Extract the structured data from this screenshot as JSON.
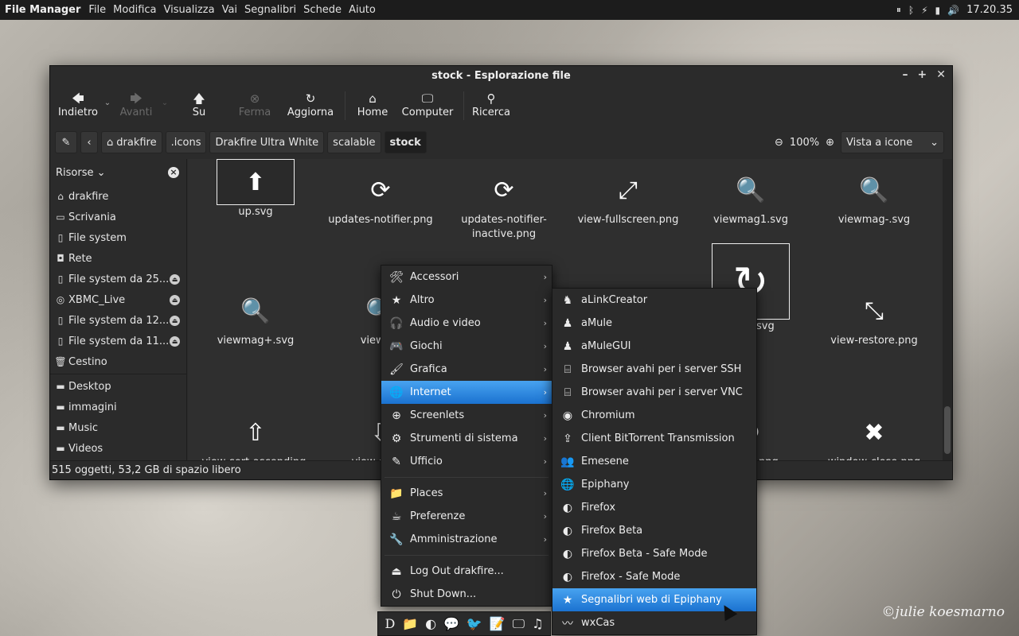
{
  "top_panel": {
    "app_name": "File Manager",
    "menus": [
      "File",
      "Modifica",
      "Visualizza",
      "Vai",
      "Segnalibri",
      "Schede",
      "Aiuto"
    ],
    "clock": "17.20.35"
  },
  "window": {
    "title": "stock - Esplorazione file",
    "toolbar": {
      "back": "Indietro",
      "forward": "Avanti",
      "up": "Su",
      "stop": "Ferma",
      "reload": "Aggiorna",
      "home": "Home",
      "computer": "Computer",
      "search": "Ricerca"
    },
    "breadcrumbs": [
      "drakfire",
      ".icons",
      "Drakfire Ultra White",
      "scalable",
      "stock"
    ],
    "zoom": "100%",
    "view_mode": "Vista a icone",
    "sidebar": {
      "header": "Risorse",
      "places": [
        {
          "label": "drakfire",
          "icon": "home-icon",
          "eject": false
        },
        {
          "label": "Scrivania",
          "icon": "desktop-icon",
          "eject": false
        },
        {
          "label": "File system",
          "icon": "drive-icon",
          "eject": false
        },
        {
          "label": "Rete",
          "icon": "network-icon",
          "eject": false
        },
        {
          "label": "File system da 25...",
          "icon": "drive-icon",
          "eject": true
        },
        {
          "label": "XBMC_Live",
          "icon": "disc-icon",
          "eject": true
        },
        {
          "label": "File system da 12...",
          "icon": "drive-icon",
          "eject": true
        },
        {
          "label": "File system da 11...",
          "icon": "drive-icon",
          "eject": true
        },
        {
          "label": "Cestino",
          "icon": "trash-icon",
          "eject": false
        }
      ],
      "bookmarks": [
        "Desktop",
        "immagini",
        "Music",
        "Videos"
      ]
    },
    "files": [
      {
        "name": "up.svg",
        "glyph": "⬆"
      },
      {
        "name": "updates-notifier.png",
        "glyph": "⟳"
      },
      {
        "name": "updates-notifier-inactive.png",
        "glyph": "⟳"
      },
      {
        "name": "view-fullscreen.png",
        "glyph": "⤢"
      },
      {
        "name": "viewmag1.svg",
        "glyph": "🔍"
      },
      {
        "name": "viewmag-.svg",
        "glyph": "🔍"
      },
      {
        "name": "viewmag+.svg",
        "glyph": "🔍"
      },
      {
        "name": "viewma",
        "glyph": "🔍"
      },
      {
        "name": "fresh.svg",
        "glyph": "↻"
      },
      {
        "name": "view-restore.png",
        "glyph": "⤡"
      },
      {
        "name": "view-sort-ascending.",
        "glyph": "⇧"
      },
      {
        "name": "view-sort-d",
        "glyph": "⇩"
      },
      {
        "name": "efresh.png",
        "glyph": "↻"
      },
      {
        "name": "window-close.png",
        "glyph": "✖"
      }
    ],
    "status": "515 oggetti, 53,2 GB di spazio libero"
  },
  "app_menu": {
    "categories": [
      {
        "label": "Accessori",
        "icon": "tools-icon",
        "glyph": "🛠",
        "submenu": true
      },
      {
        "label": "Altro",
        "icon": "star-icon",
        "glyph": "★",
        "submenu": true
      },
      {
        "label": "Audio e video",
        "icon": "headphones-icon",
        "glyph": "🎧",
        "submenu": true
      },
      {
        "label": "Giochi",
        "icon": "gamepad-icon",
        "glyph": "🎮",
        "submenu": true
      },
      {
        "label": "Grafica",
        "icon": "brush-icon",
        "glyph": "🖌",
        "submenu": true
      },
      {
        "label": "Internet",
        "icon": "globe-icon",
        "glyph": "🌐",
        "submenu": true,
        "highlight": true
      },
      {
        "label": "Screenlets",
        "icon": "plus-circle-icon",
        "glyph": "⊕",
        "submenu": true
      },
      {
        "label": "Strumenti di sistema",
        "icon": "gear-icon",
        "glyph": "⚙",
        "submenu": true
      },
      {
        "label": "Ufficio",
        "icon": "office-icon",
        "glyph": "✎",
        "submenu": true
      }
    ],
    "places": [
      {
        "label": "Places",
        "icon": "folder-icon",
        "glyph": "📁",
        "submenu": true
      },
      {
        "label": "Preferenze",
        "icon": "preferences-icon",
        "glyph": "☕",
        "submenu": true
      },
      {
        "label": "Amministrazione",
        "icon": "wrench-icon",
        "glyph": "🔧",
        "submenu": true
      }
    ],
    "session": [
      {
        "label": "Log Out drakfire...",
        "icon": "logout-icon",
        "glyph": "⏏"
      },
      {
        "label": "Shut Down...",
        "icon": "power-icon",
        "glyph": "⏻"
      }
    ]
  },
  "internet_submenu": [
    {
      "label": "aLinkCreator",
      "icon": "alinkcreator-icon",
      "glyph": "♞"
    },
    {
      "label": "aMule",
      "icon": "amule-icon",
      "glyph": "♟"
    },
    {
      "label": "aMuleGUI",
      "icon": "amulegui-icon",
      "glyph": "♟"
    },
    {
      "label": "Browser avahi per i server SSH",
      "icon": "network-icon",
      "glyph": "⌸"
    },
    {
      "label": "Browser avahi per i server VNC",
      "icon": "network-icon",
      "glyph": "⌸"
    },
    {
      "label": "Chromium",
      "icon": "chromium-icon",
      "glyph": "◉"
    },
    {
      "label": "Client BitTorrent Transmission",
      "icon": "transmission-icon",
      "glyph": "⇪"
    },
    {
      "label": "Emesene",
      "icon": "emesene-icon",
      "glyph": "👥"
    },
    {
      "label": "Epiphany",
      "icon": "epiphany-icon",
      "glyph": "🌐"
    },
    {
      "label": "Firefox",
      "icon": "firefox-icon",
      "glyph": "◐"
    },
    {
      "label": "Firefox Beta",
      "icon": "firefox-icon",
      "glyph": "◐"
    },
    {
      "label": "Firefox Beta - Safe Mode",
      "icon": "firefox-icon",
      "glyph": "◐"
    },
    {
      "label": "Firefox - Safe Mode",
      "icon": "firefox-icon",
      "glyph": "◐"
    },
    {
      "label": "Segnalibri web di Epiphany",
      "icon": "star-icon",
      "glyph": "★",
      "highlight": true
    },
    {
      "label": "wxCas",
      "icon": "wxcas-icon",
      "glyph": "〰"
    }
  ],
  "dock": [
    "D",
    "📁",
    "◐",
    "💬",
    "🐦",
    "📝",
    "🖵",
    "♫"
  ],
  "watermark": "©julie koesmarno"
}
